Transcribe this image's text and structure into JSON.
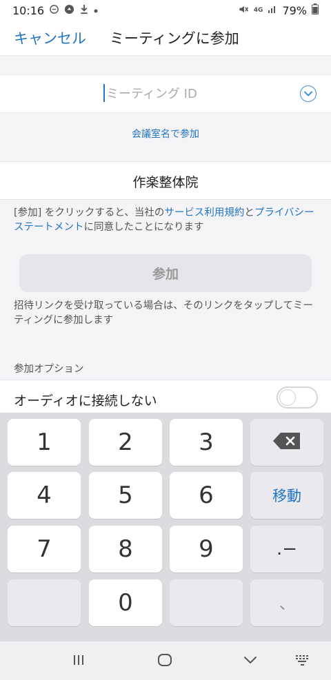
{
  "status_bar": {
    "time": "10:16",
    "network": "4G",
    "battery": "79%",
    "icons": [
      "chat-bubble-icon",
      "stop-sign-icon",
      "download-icon",
      "dot-icon",
      "mute-vibrate-icon",
      "signal-icon",
      "battery-icon"
    ]
  },
  "header": {
    "cancel_label": "キャンセル",
    "title": "ミーティングに参加"
  },
  "meeting_id": {
    "placeholder": "ミーティング ID",
    "value": "",
    "dropdown_icon": "chevron-down-circle-icon"
  },
  "room_link": "会議室名で参加",
  "display_name": "作楽整体院",
  "legal": {
    "part1": "[参加] をクリックすると、当社の",
    "terms_link": "サービス利用規約",
    "part2": "と",
    "privacy_link": "プライバシーステートメント",
    "part3": "に同意したことになります"
  },
  "join_button": "参加",
  "invite_note": "招待リンクを受け取っている場合は、そのリンクをタップしてミーティングに参加します",
  "options": {
    "heading": "参加オプション",
    "audio_label": "オーディオに接続しない",
    "audio_toggle_on": false
  },
  "keyboard": {
    "keys": [
      "1",
      "2",
      "3",
      "4",
      "5",
      "6",
      "7",
      "8",
      "9",
      "0"
    ],
    "backspace_icon": "backspace-icon",
    "move_label": "移動",
    "punct_label": ".−",
    "comma_label": "、"
  },
  "nav_bar": {
    "icons": [
      "recent-apps-icon",
      "home-icon",
      "back-icon",
      "keyboard-hide-icon"
    ]
  },
  "colors": {
    "accent": "#1f74c6",
    "background": "#f4f4f6"
  }
}
